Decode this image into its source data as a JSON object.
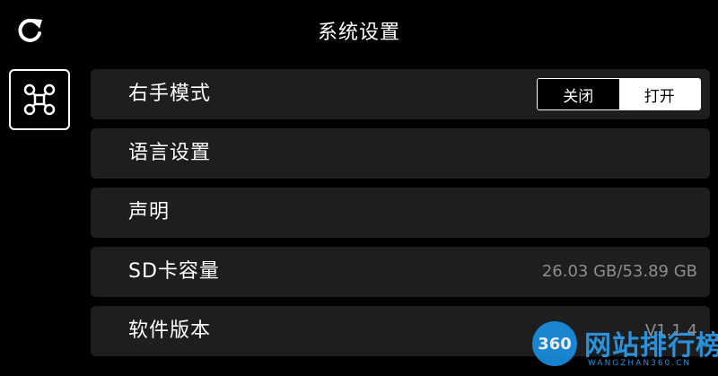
{
  "header": {
    "title": "系统设置",
    "refresh_icon": "refresh-icon"
  },
  "sidebar": {
    "tabs": [
      {
        "icon": "drone-icon",
        "active": true
      }
    ]
  },
  "settings": {
    "right_hand_mode": {
      "label": "右手模式",
      "options": [
        "关闭",
        "打开"
      ],
      "selected": "打开"
    },
    "language": {
      "label": "语言设置"
    },
    "statement": {
      "label": "声明"
    },
    "sd_capacity": {
      "label": "SD卡容量",
      "value": "26.03 GB/53.89 GB"
    },
    "software_version": {
      "label": "软件版本",
      "value": "V1.1.4"
    }
  },
  "watermark": {
    "badge": "360",
    "name": "网站排行榜",
    "site": "WANGZHAN360.CN"
  },
  "colors": {
    "background": "#000000",
    "row_background": "#1e1e1e",
    "text": "#ffffff",
    "secondary_text": "#8d8d8d",
    "watermark_blue": "#2d9be8"
  }
}
